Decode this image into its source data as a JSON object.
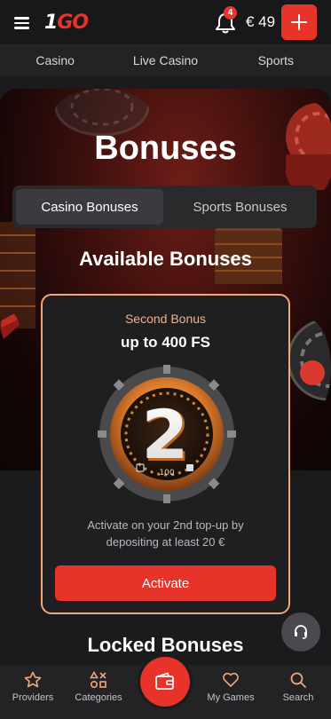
{
  "header": {
    "logo_part1": "1",
    "logo_part2": "GO",
    "notifications_count": "4",
    "balance": "€ 49"
  },
  "nav": {
    "items": [
      {
        "label": "Casino"
      },
      {
        "label": "Live Casino"
      },
      {
        "label": "Sports"
      }
    ]
  },
  "hero": {
    "title": "Bonuses",
    "tabs": [
      {
        "label": "Casino Bonuses",
        "active": true
      },
      {
        "label": "Sports Bonuses",
        "active": false
      }
    ],
    "available_heading": "Available Bonuses"
  },
  "bonus_card": {
    "subtitle": "Second Bonus",
    "title": "up to 400 FS",
    "badge_number": "2",
    "badge_gauge_label": "100",
    "description": "Activate on your 2nd top-up by depositing at least 20 €",
    "activate_label": "Activate"
  },
  "locked_heading": "Locked Bonuses",
  "bottom_nav": {
    "items": [
      {
        "label": "Providers",
        "icon": "star-icon"
      },
      {
        "label": "Categories",
        "icon": "categories-icon"
      },
      {
        "label": "My Games",
        "icon": "heart-icon"
      },
      {
        "label": "Search",
        "icon": "search-icon"
      }
    ],
    "center_icon": "wallet-icon"
  },
  "colors": {
    "accent": "#e8332a",
    "card_border": "#f0a87a",
    "card_subtitle": "#f3b088"
  }
}
